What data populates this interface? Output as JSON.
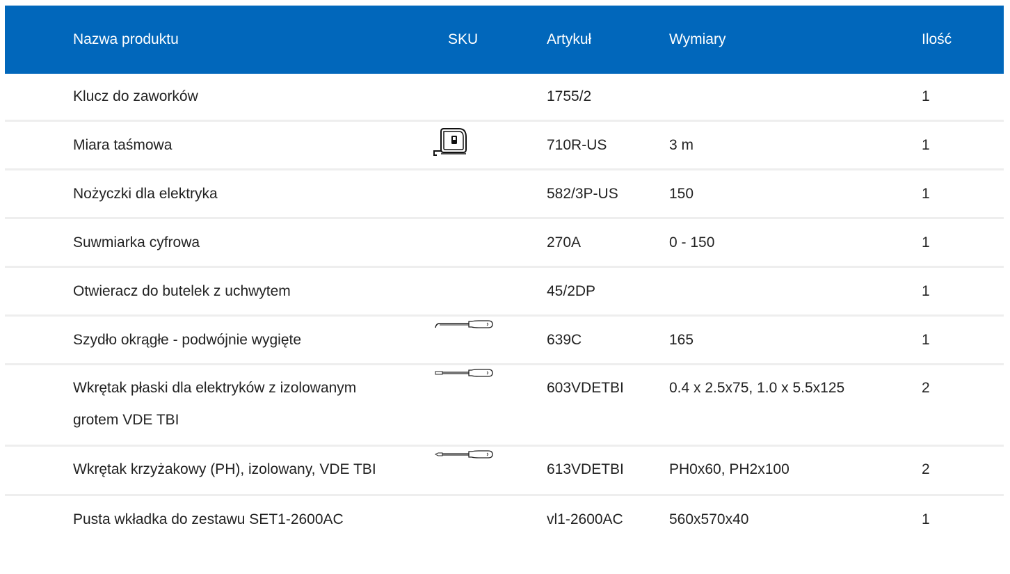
{
  "table": {
    "headers": {
      "name": "Nazwa produktu",
      "sku": "SKU",
      "article": "Artykuł",
      "dims": "Wymiary",
      "qty": "Ilość"
    },
    "rows": [
      {
        "name": "Klucz do zaworków",
        "sku_icon": "",
        "article": "1755/2",
        "dims": "",
        "qty": "1"
      },
      {
        "name": "Miara taśmowa",
        "sku_icon": "tape-measure-icon",
        "article": "710R-US",
        "dims": "3 m",
        "qty": "1"
      },
      {
        "name": "Nożyczki dla elektryka",
        "sku_icon": "",
        "article": "582/3P-US",
        "dims": "150",
        "qty": "1"
      },
      {
        "name": "Suwmiarka cyfrowa",
        "sku_icon": "",
        "article": "270A",
        "dims": "0 - 150",
        "qty": "1"
      },
      {
        "name": "Otwieracz do butelek z uchwytem",
        "sku_icon": "",
        "article": "45/2DP",
        "dims": "",
        "qty": "1"
      },
      {
        "name": "Szydło okrągłe - podwójnie wygięte",
        "sku_icon": "awl-icon",
        "article": "639C",
        "dims": "165",
        "qty": "1"
      },
      {
        "name": "Wkrętak płaski dla elektryków z izolowanym grotem VDE TBI",
        "sku_icon": "screwdriver-flat-icon",
        "article": "603VDETBI",
        "dims": "0.4 x 2.5x75, 1.0 x 5.5x125",
        "qty": "2"
      },
      {
        "name": "Wkrętak krzyżakowy (PH), izolowany, VDE TBI",
        "sku_icon": "screwdriver-phillips-icon",
        "article": "613VDETBI",
        "dims": "PH0x60, PH2x100",
        "qty": "2"
      },
      {
        "name": "Pusta wkładka do zestawu SET1-2600AC",
        "sku_icon": "",
        "article": "vl1-2600AC",
        "dims": "560x570x40",
        "qty": "1"
      }
    ]
  },
  "colors": {
    "header_bg": "#0167bb",
    "header_text": "#ffffff",
    "row_divider": "#eeeeee",
    "body_text": "#222222"
  }
}
